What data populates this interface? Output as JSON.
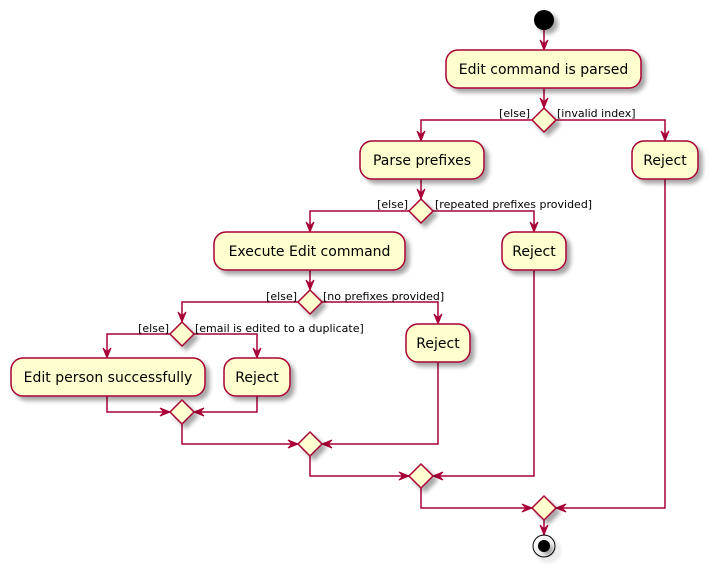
{
  "colors": {
    "fill": "#FEFECE",
    "stroke": "#A80036",
    "shadow": "#C8C8C8"
  },
  "activities": {
    "parsed": "Edit command is parsed",
    "parse_prefixes": "Parse prefixes",
    "reject_invalid": "Reject",
    "execute": "Execute Edit command",
    "reject_repeated": "Reject",
    "reject_no_prefix": "Reject",
    "edit_success": "Edit person successfully",
    "reject_duplicate": "Reject"
  },
  "guards": {
    "d1_else": "[else]",
    "d1_then": "[invalid index]",
    "d2_else": "[else]",
    "d2_then": "[repeated prefixes provided]",
    "d3_else": "[else]",
    "d3_then": "[no prefixes provided]",
    "d4_else": "[else]",
    "d4_then": "[email is edited to a duplicate]"
  }
}
